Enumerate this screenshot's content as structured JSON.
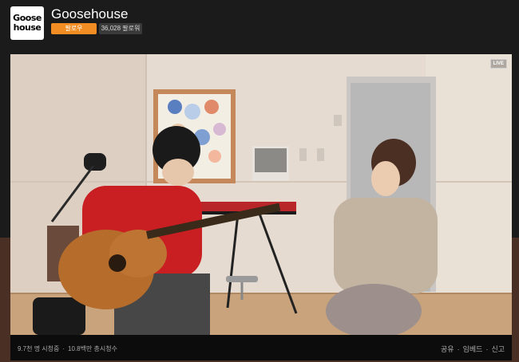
{
  "channel": {
    "logo_text_1": "Goose",
    "logo_text_2": "house",
    "name": "Goosehouse",
    "follow_label": "팔로우",
    "followers": "36,028 팔로워"
  },
  "player": {
    "live_badge": "LIVE",
    "viewers": "9.7천 명 시청중",
    "total_views": "10.8백만 총시청수",
    "share_label": "공유",
    "embed_label": "임베드",
    "report_label": "신고"
  },
  "colors": {
    "accent": "#f28d23",
    "background": "#1b1b1b"
  }
}
